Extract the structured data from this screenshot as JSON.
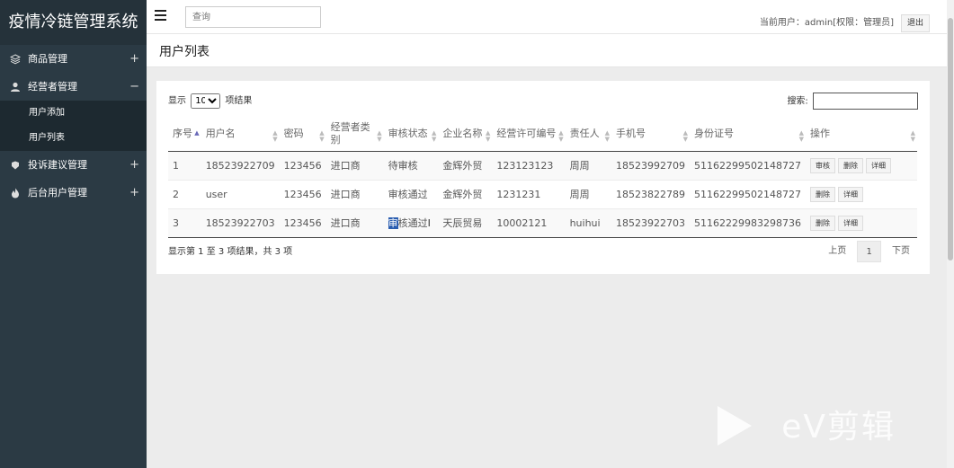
{
  "app": {
    "title": "疫情冷链管理系统"
  },
  "sidebar": {
    "groups": [
      {
        "label": "商品管理",
        "icon": "layers-icon",
        "toggle": "+"
      },
      {
        "label": "经营者管理",
        "icon": "user-icon",
        "toggle": "−",
        "items": [
          {
            "label": "用户添加"
          },
          {
            "label": "用户列表"
          }
        ]
      },
      {
        "label": "投诉建议管理",
        "icon": "complaint-icon",
        "toggle": "+"
      },
      {
        "label": "后台用户管理",
        "icon": "fire-icon",
        "toggle": "+"
      }
    ]
  },
  "topbar": {
    "search_placeholder": "查询",
    "user_info": "当前用户：admin[权限：管理员]",
    "logout_label": "退出"
  },
  "page": {
    "title": "用户列表"
  },
  "table_controls": {
    "show_prefix": "显示",
    "page_size": "10",
    "show_suffix": "项结果",
    "search_label": "搜索:"
  },
  "table": {
    "columns": [
      "序号",
      "用户名",
      "密码",
      "经营者类别",
      "审核状态",
      "企业名称",
      "经营许可编号",
      "责任人",
      "手机号",
      "身份证号",
      "操作"
    ],
    "rows": [
      {
        "no": "1",
        "username": "18523922709",
        "password": "123456",
        "category": "进口商",
        "status": "待审核",
        "company": "金辉外贸",
        "license": "123123123",
        "owner": "周周",
        "phone": "18523992709",
        "idcard": "51162299502148727",
        "actions": [
          "审核",
          "删除",
          "详细"
        ]
      },
      {
        "no": "2",
        "username": "user",
        "password": "123456",
        "category": "进口商",
        "status": "审核通过",
        "company": "金辉外贸",
        "license": "1231231",
        "owner": "周周",
        "phone": "18523822789",
        "idcard": "51162299502148727",
        "actions": [
          "删除",
          "详细"
        ]
      },
      {
        "no": "3",
        "username": "18523922703",
        "password": "123456",
        "category": "进口商",
        "status_hl": "审",
        "status_rest": "核通过",
        "company": "天辰贸易",
        "license": "10002121",
        "owner": "huihui",
        "phone": "18523922703",
        "idcard": "51162229983298736",
        "actions": [
          "删除",
          "详细"
        ]
      }
    ]
  },
  "footer": {
    "info": "显示第 1 至 3 项结果，共 3 项",
    "prev": "上页",
    "current_page": "1",
    "next": "下页"
  },
  "watermark": {
    "text": "eV剪辑"
  },
  "colors": {
    "sidebar_bg": "#2b3a44",
    "sidebar_sub_bg": "#1d2930",
    "selection": "#2a5db0"
  }
}
